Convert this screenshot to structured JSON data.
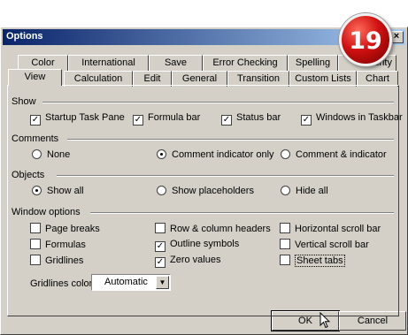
{
  "window": {
    "title": "Options",
    "close_label": "×"
  },
  "badge": {
    "text": "19"
  },
  "tabs_row1": [
    "Color",
    "International",
    "Save",
    "Error Checking",
    "Spelling",
    "Security"
  ],
  "tabs_row2": [
    "View",
    "Calculation",
    "Edit",
    "General",
    "Transition",
    "Custom Lists",
    "Chart"
  ],
  "active_tab": "View",
  "show": {
    "heading": "Show",
    "items": [
      {
        "label": "Startup Task Pane",
        "checked": true
      },
      {
        "label": "Formula bar",
        "checked": true
      },
      {
        "label": "Status bar",
        "checked": true
      },
      {
        "label": "Windows in Taskbar",
        "checked": true
      }
    ]
  },
  "comments": {
    "heading": "Comments",
    "options": [
      {
        "label": "None",
        "selected": false
      },
      {
        "label": "Comment indicator only",
        "selected": true
      },
      {
        "label": "Comment & indicator",
        "selected": false
      }
    ]
  },
  "objects": {
    "heading": "Objects",
    "options": [
      {
        "label": "Show all",
        "selected": true
      },
      {
        "label": "Show placeholders",
        "selected": false
      },
      {
        "label": "Hide all",
        "selected": false
      }
    ]
  },
  "window_options": {
    "heading": "Window options",
    "items": [
      {
        "label": "Page breaks",
        "checked": false
      },
      {
        "label": "Row & column headers",
        "checked": false
      },
      {
        "label": "Horizontal scroll bar",
        "checked": false
      },
      {
        "label": "Formulas",
        "checked": false
      },
      {
        "label": "Outline symbols",
        "checked": true
      },
      {
        "label": "Vertical scroll bar",
        "checked": false
      },
      {
        "label": "Gridlines",
        "checked": false
      },
      {
        "label": "Zero values",
        "checked": true
      },
      {
        "label": "Sheet tabs",
        "checked": false
      }
    ]
  },
  "gridlines_color": {
    "label": "Gridlines color:",
    "value": "Automatic"
  },
  "buttons": {
    "ok": "OK",
    "cancel": "Cancel"
  },
  "colors": {
    "title_start": "#0a246a",
    "title_end": "#a6caf0",
    "face": "#d4d0c8",
    "badge": "#d01010"
  }
}
